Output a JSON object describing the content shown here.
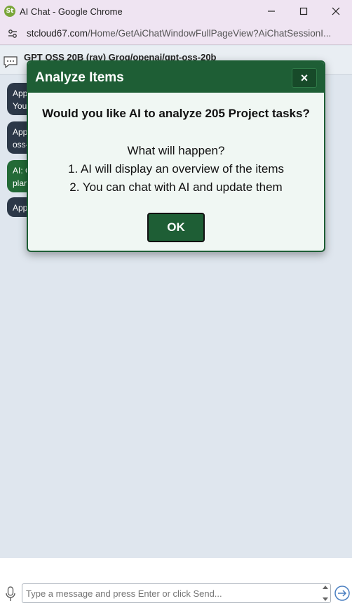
{
  "window": {
    "app_icon_text": "St",
    "title": "AI Chat - Google Chrome",
    "controls": {
      "minimize": "minimize-icon",
      "maximize": "maximize-icon",
      "close": "close-icon"
    }
  },
  "address": {
    "domain": "stcloud67.com",
    "path": "/Home/GetAiChatWindowFullPageView?AiChatSessionI..."
  },
  "chat": {
    "header_title": "GPT OSS 20B (ray)  Groq/openai/gpt-oss-20b",
    "messages": [
      {
        "style": "dark",
        "line1": "App",
        "line2": "You"
      },
      {
        "style": "dark",
        "line1": "App",
        "line2": "oss-"
      },
      {
        "style": "green",
        "line1": "AI: C",
        "line2": "plar"
      },
      {
        "style": "dark",
        "line1": "App",
        "line2": ""
      }
    ],
    "input_placeholder": "Type a message and press Enter or click Send..."
  },
  "modal": {
    "title": "Analyze Items",
    "close_label": "×",
    "question": "Would you like AI to analyze 205 Project tasks?",
    "subheading": "What will happen?",
    "steps": [
      "1. AI will display an overview of the items",
      "2. You can chat with AI and update them"
    ],
    "ok_label": "OK"
  },
  "colors": {
    "modal_header": "#1e5e35",
    "modal_body": "#f0f7f3",
    "bubble_dark": "#2c3848",
    "bubble_green": "#236a37",
    "chrome_frame": "#efe4f2"
  }
}
